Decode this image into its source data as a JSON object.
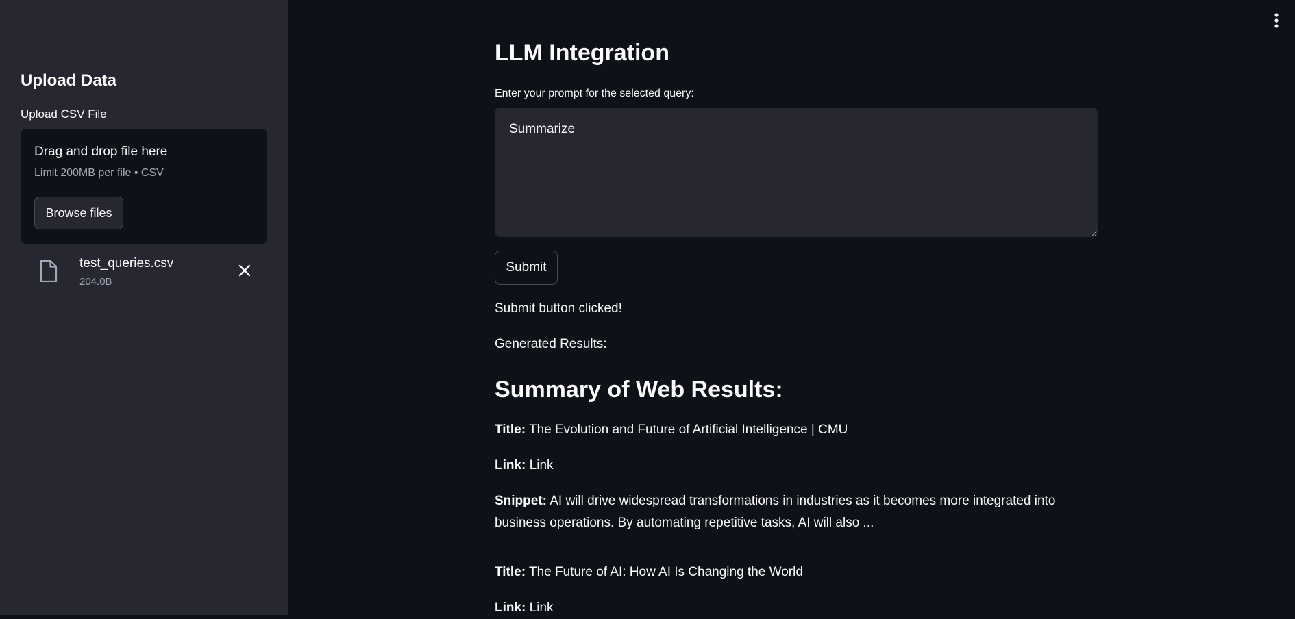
{
  "sidebar": {
    "title": "Upload Data",
    "upload_label": "Upload CSV File",
    "dropzone": {
      "main_text": "Drag and drop file here",
      "sub_text": "Limit 200MB per file • CSV",
      "browse_label": "Browse files"
    },
    "file": {
      "name": "test_queries.csv",
      "size": "204.0B",
      "icon": "file-icon",
      "remove_icon": "close-icon"
    }
  },
  "header": {
    "menu_icon": "more-vertical-icon"
  },
  "main": {
    "title": "LLM Integration",
    "prompt_label": "Enter your prompt for the selected query:",
    "prompt_value": "Summarize",
    "submit_label": "Submit",
    "status_text": "Submit button clicked!",
    "generated_label": "Generated Results:",
    "results_heading": "Summary of Web Results:",
    "results": [
      {
        "title_label": "Title:",
        "title": "The Evolution and Future of Artificial Intelligence | CMU",
        "link_label": "Link:",
        "link_text": "Link",
        "snippet_label": "Snippet:",
        "snippet": "AI will drive widespread transformations in industries as it becomes more integrated into business operations. By automating repetitive tasks, AI will also ..."
      },
      {
        "title_label": "Title:",
        "title": "The Future of AI: How AI Is Changing the World",
        "link_label": "Link:",
        "link_text": "Link"
      }
    ]
  },
  "colors": {
    "background": "#0e1117",
    "sidebar_bg": "#262730",
    "text": "#fafafa",
    "muted": "#a3a8b4"
  }
}
